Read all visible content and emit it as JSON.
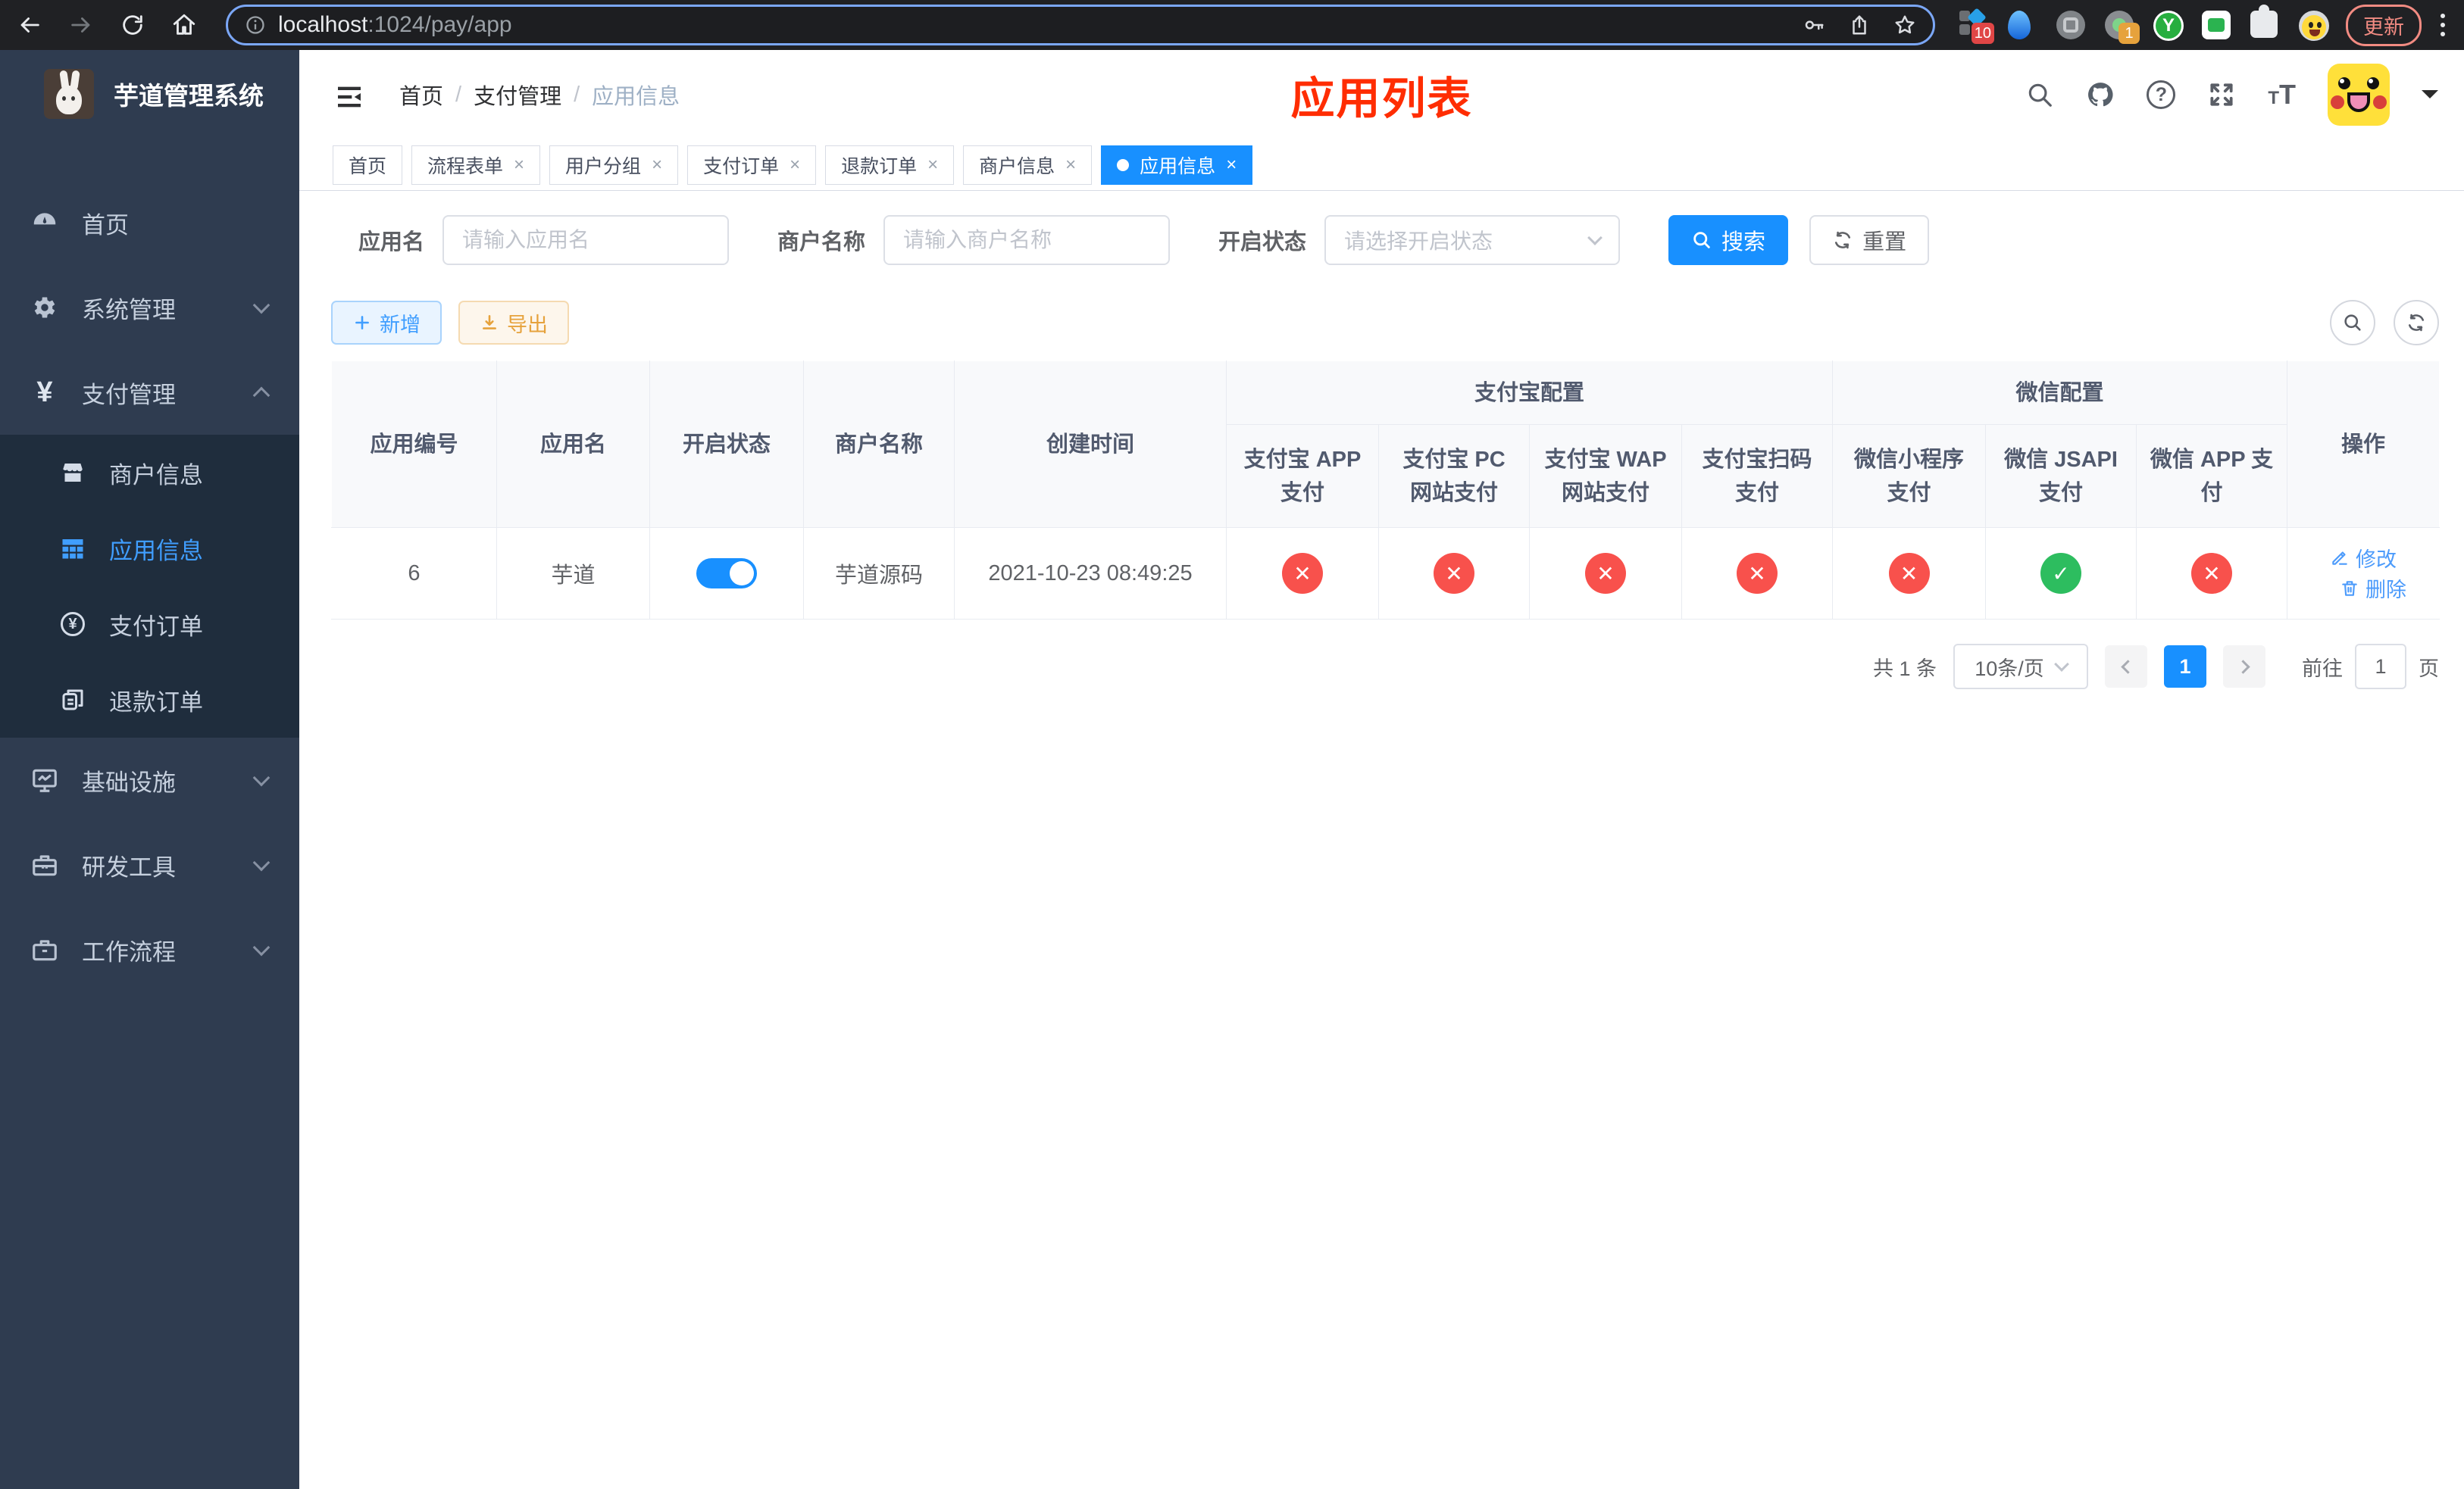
{
  "browser": {
    "url_host": "localhost",
    "url_path": ":1024/pay/app",
    "update_label": "更新",
    "extension_badge_a": "10",
    "extension_badge_b": "1",
    "extension_y_letter": "Y"
  },
  "sidebar": {
    "title": "芋道管理系统",
    "items": [
      {
        "label": "首页"
      },
      {
        "label": "系统管理"
      },
      {
        "label": "支付管理"
      },
      {
        "label": "基础设施"
      },
      {
        "label": "研发工具"
      },
      {
        "label": "工作流程"
      }
    ],
    "payment_submenu": [
      {
        "label": "商户信息"
      },
      {
        "label": "应用信息"
      },
      {
        "label": "支付订单"
      },
      {
        "label": "退款订单"
      }
    ],
    "yen_symbol": "¥"
  },
  "topbar": {
    "breadcrumb": [
      "首页",
      "支付管理",
      "应用信息"
    ],
    "separator": "/",
    "page_title": "应用列表",
    "font_icon_small": "T",
    "font_icon_large": "T",
    "help_glyph": "?"
  },
  "tabs": {
    "close_symbol": "×",
    "items": [
      {
        "label": "首页"
      },
      {
        "label": "流程表单"
      },
      {
        "label": "用户分组"
      },
      {
        "label": "支付订单"
      },
      {
        "label": "退款订单"
      },
      {
        "label": "商户信息"
      },
      {
        "label": "应用信息"
      }
    ]
  },
  "filters": {
    "app_name_label": "应用名",
    "app_name_placeholder": "请输入应用名",
    "merchant_label": "商户名称",
    "merchant_placeholder": "请输入商户名称",
    "status_label": "开启状态",
    "status_placeholder": "请选择开启状态",
    "search_label": "搜索",
    "reset_label": "重置"
  },
  "toolbar": {
    "add_label": "新增",
    "export_label": "导出"
  },
  "table": {
    "group_alipay": "支付宝配置",
    "group_wechat": "微信配置",
    "columns_left": [
      "应用编号",
      "应用名",
      "开启状态",
      "商户名称",
      "创建时间"
    ],
    "columns_alipay": [
      "支付宝 APP 支付",
      "支付宝 PC 网站支付",
      "支付宝 WAP 网站支付",
      "支付宝扫码支付"
    ],
    "columns_wechat": [
      "微信小程序支付",
      "微信 JSAPI 支付",
      "微信 APP 支付"
    ],
    "column_actions": "操作",
    "status_glyphs": {
      "ok": "✓",
      "fail": "✕"
    },
    "rows": [
      {
        "id": "6",
        "name": "芋道",
        "enabled": true,
        "merchant": "芋道源码",
        "created": "2021-10-23 08:49:25",
        "channels": [
          {
            "name": "alipay_app",
            "enabled": false
          },
          {
            "name": "alipay_pc",
            "enabled": false
          },
          {
            "name": "alipay_wap",
            "enabled": false
          },
          {
            "name": "alipay_qr",
            "enabled": false
          },
          {
            "name": "wechat_lite",
            "enabled": false
          },
          {
            "name": "wechat_jsapi",
            "enabled": true
          },
          {
            "name": "wechat_app",
            "enabled": false
          }
        ],
        "edit_label": "修改",
        "delete_label": "删除"
      }
    ]
  },
  "pagination": {
    "total": "共 1 条",
    "page_size": "10条/页",
    "current_page": "1",
    "goto_label": "前往",
    "goto_value": "1",
    "unit_label": "页"
  },
  "colors": {
    "accent": "#1890ff",
    "link_blue": "#409eff",
    "success_green": "#2dbd5f",
    "danger_red": "#f8514c",
    "title_red": "#ff2d02",
    "sidebar_bg": "#2f3c50",
    "submenu_bg": "#1f2d3d"
  }
}
